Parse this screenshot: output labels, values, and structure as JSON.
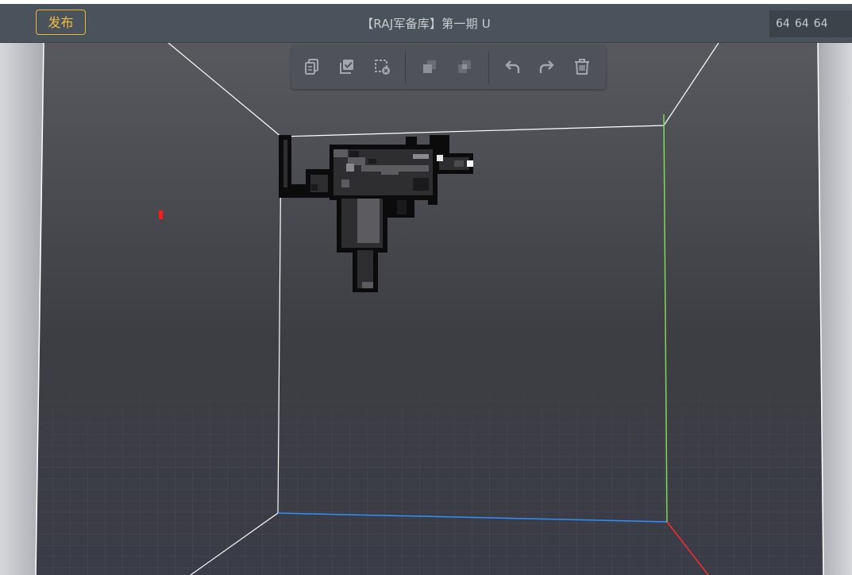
{
  "header": {
    "publish_label": "发布",
    "title": "【RAJ军备库】第一期 U",
    "size": [
      "64",
      "64",
      "64"
    ]
  },
  "toolbar": {
    "items": [
      {
        "icon": "copy-icon"
      },
      {
        "icon": "paste-check-icon"
      },
      {
        "icon": "clear-selection-icon"
      },
      {
        "icon": "layer-front-icon"
      },
      {
        "icon": "layer-back-icon"
      },
      {
        "icon": "undo-icon"
      },
      {
        "icon": "redo-icon"
      },
      {
        "icon": "trash-icon"
      }
    ]
  },
  "scene": {
    "model": "voxel-uzi",
    "axes_colors": {
      "x": "#ff2a2a",
      "y": "#7ed957",
      "z": "#2f8fff"
    }
  },
  "colors": {
    "header_bg": "#4a525b",
    "accent": "#f2bd3f",
    "viewport_bg": "#3f4046"
  }
}
